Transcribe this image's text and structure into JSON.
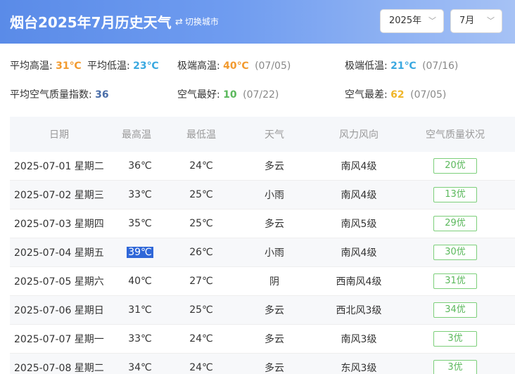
{
  "header": {
    "title": "烟台2025年7月历史天气",
    "switch_icon": "swap-arrows-icon",
    "switch_city": "切换城市",
    "year_select": "2025年",
    "month_select": "7月",
    "chevron_icon": "chevron-down-icon"
  },
  "stats": {
    "avg_high_label": "平均高温:",
    "avg_high_value": "31℃",
    "avg_low_label": "平均低温:",
    "avg_low_value": "23℃",
    "ext_high_label": "极端高温:",
    "ext_high_value": "40℃",
    "ext_high_date": "(07/05)",
    "ext_low_label": "极端低温:",
    "ext_low_value": "21℃",
    "ext_low_date": "(07/16)",
    "avg_aqi_label": "平均空气质量指数:",
    "avg_aqi_value": "36",
    "best_aqi_label": "空气最好:",
    "best_aqi_value": "10",
    "best_aqi_date": "(07/22)",
    "worst_aqi_label": "空气最差:",
    "worst_aqi_value": "62",
    "worst_aqi_date": "(07/05)"
  },
  "colors": {
    "header_gradient_start": "#5a8be8",
    "high_temp": "#f29a2e",
    "low_temp": "#39a8e0",
    "aqi_good": "#5bb85c",
    "aqi_worst": "#f0b62a",
    "selection": "#2f67d8"
  },
  "table": {
    "headers": [
      "日期",
      "最高温",
      "最低温",
      "天气",
      "风力风向",
      "空气质量状况"
    ],
    "rows": [
      {
        "date": "2025-07-01 星期二",
        "high": "36℃",
        "low": "24℃",
        "weather": "多云",
        "wind": "南风4级",
        "aqi": "20优"
      },
      {
        "date": "2025-07-02 星期三",
        "high": "33℃",
        "low": "25℃",
        "weather": "小雨",
        "wind": "南风4级",
        "aqi": "13优"
      },
      {
        "date": "2025-07-03 星期四",
        "high": "35℃",
        "low": "25℃",
        "weather": "多云",
        "wind": "南风5级",
        "aqi": "29优"
      },
      {
        "date": "2025-07-04 星期五",
        "high": "39℃",
        "low": "26℃",
        "weather": "小雨",
        "wind": "南风4级",
        "aqi": "30优"
      },
      {
        "date": "2025-07-05 星期六",
        "high": "40℃",
        "low": "27℃",
        "weather": "阴",
        "wind": "西南风4级",
        "aqi": "31优"
      },
      {
        "date": "2025-07-06 星期日",
        "high": "31℃",
        "low": "25℃",
        "weather": "多云",
        "wind": "西北风3级",
        "aqi": "34优"
      },
      {
        "date": "2025-07-07 星期一",
        "high": "33℃",
        "low": "24℃",
        "weather": "多云",
        "wind": "南风3级",
        "aqi": "3优"
      },
      {
        "date": "2025-07-08 星期二",
        "high": "34℃",
        "low": "24℃",
        "weather": "多云",
        "wind": "东风3级",
        "aqi": "3优"
      }
    ]
  }
}
